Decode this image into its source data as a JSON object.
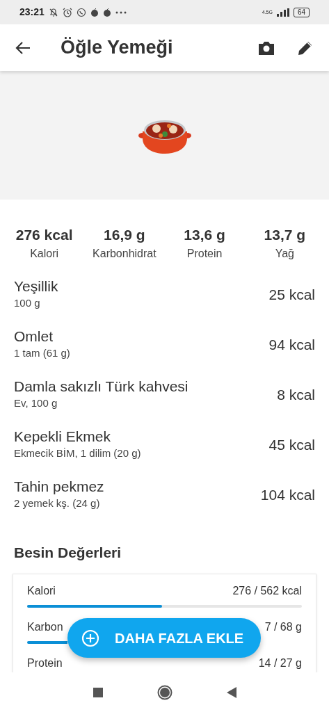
{
  "status_bar": {
    "time": "23:21",
    "network": "4.5G",
    "battery": "64"
  },
  "header": {
    "title": "Öğle Yemeği"
  },
  "summary": [
    {
      "value": "276 kcal",
      "label": "Kalori"
    },
    {
      "value": "16,9 g",
      "label": "Karbonhidrat"
    },
    {
      "value": "13,6 g",
      "label": "Protein"
    },
    {
      "value": "13,7 g",
      "label": "Yağ"
    }
  ],
  "foods": [
    {
      "name": "Yeşillik",
      "portion": "100 g",
      "calories": "25 kcal"
    },
    {
      "name": "Omlet",
      "portion": "1 tam (61 g)",
      "calories": "94 kcal"
    },
    {
      "name": "Damla sakızlı Türk kahvesi",
      "portion": "Ev, 100 g",
      "calories": "8 kcal"
    },
    {
      "name": "Kepekli Ekmek",
      "portion": "Ekmecik BİM, 1 dilim (20 g)",
      "calories": "45 kcal"
    },
    {
      "name": "Tahin pekmez",
      "portion": "2 yemek kş. (24 g)",
      "calories": "104 kcal"
    }
  ],
  "nutrients": {
    "title": "Besin Değerleri",
    "rows": [
      {
        "kind": "meter",
        "label": "Kalori",
        "reading": "276 / 562 kcal",
        "level": 0.49
      },
      {
        "kind": "covered",
        "label": "Karbon",
        "reading": "7 / 68 g"
      },
      {
        "kind": "plain",
        "label": "Protein",
        "reading": "14 / 27 g"
      }
    ]
  },
  "fab": {
    "label": "DAHA FAZLA EKLE"
  }
}
